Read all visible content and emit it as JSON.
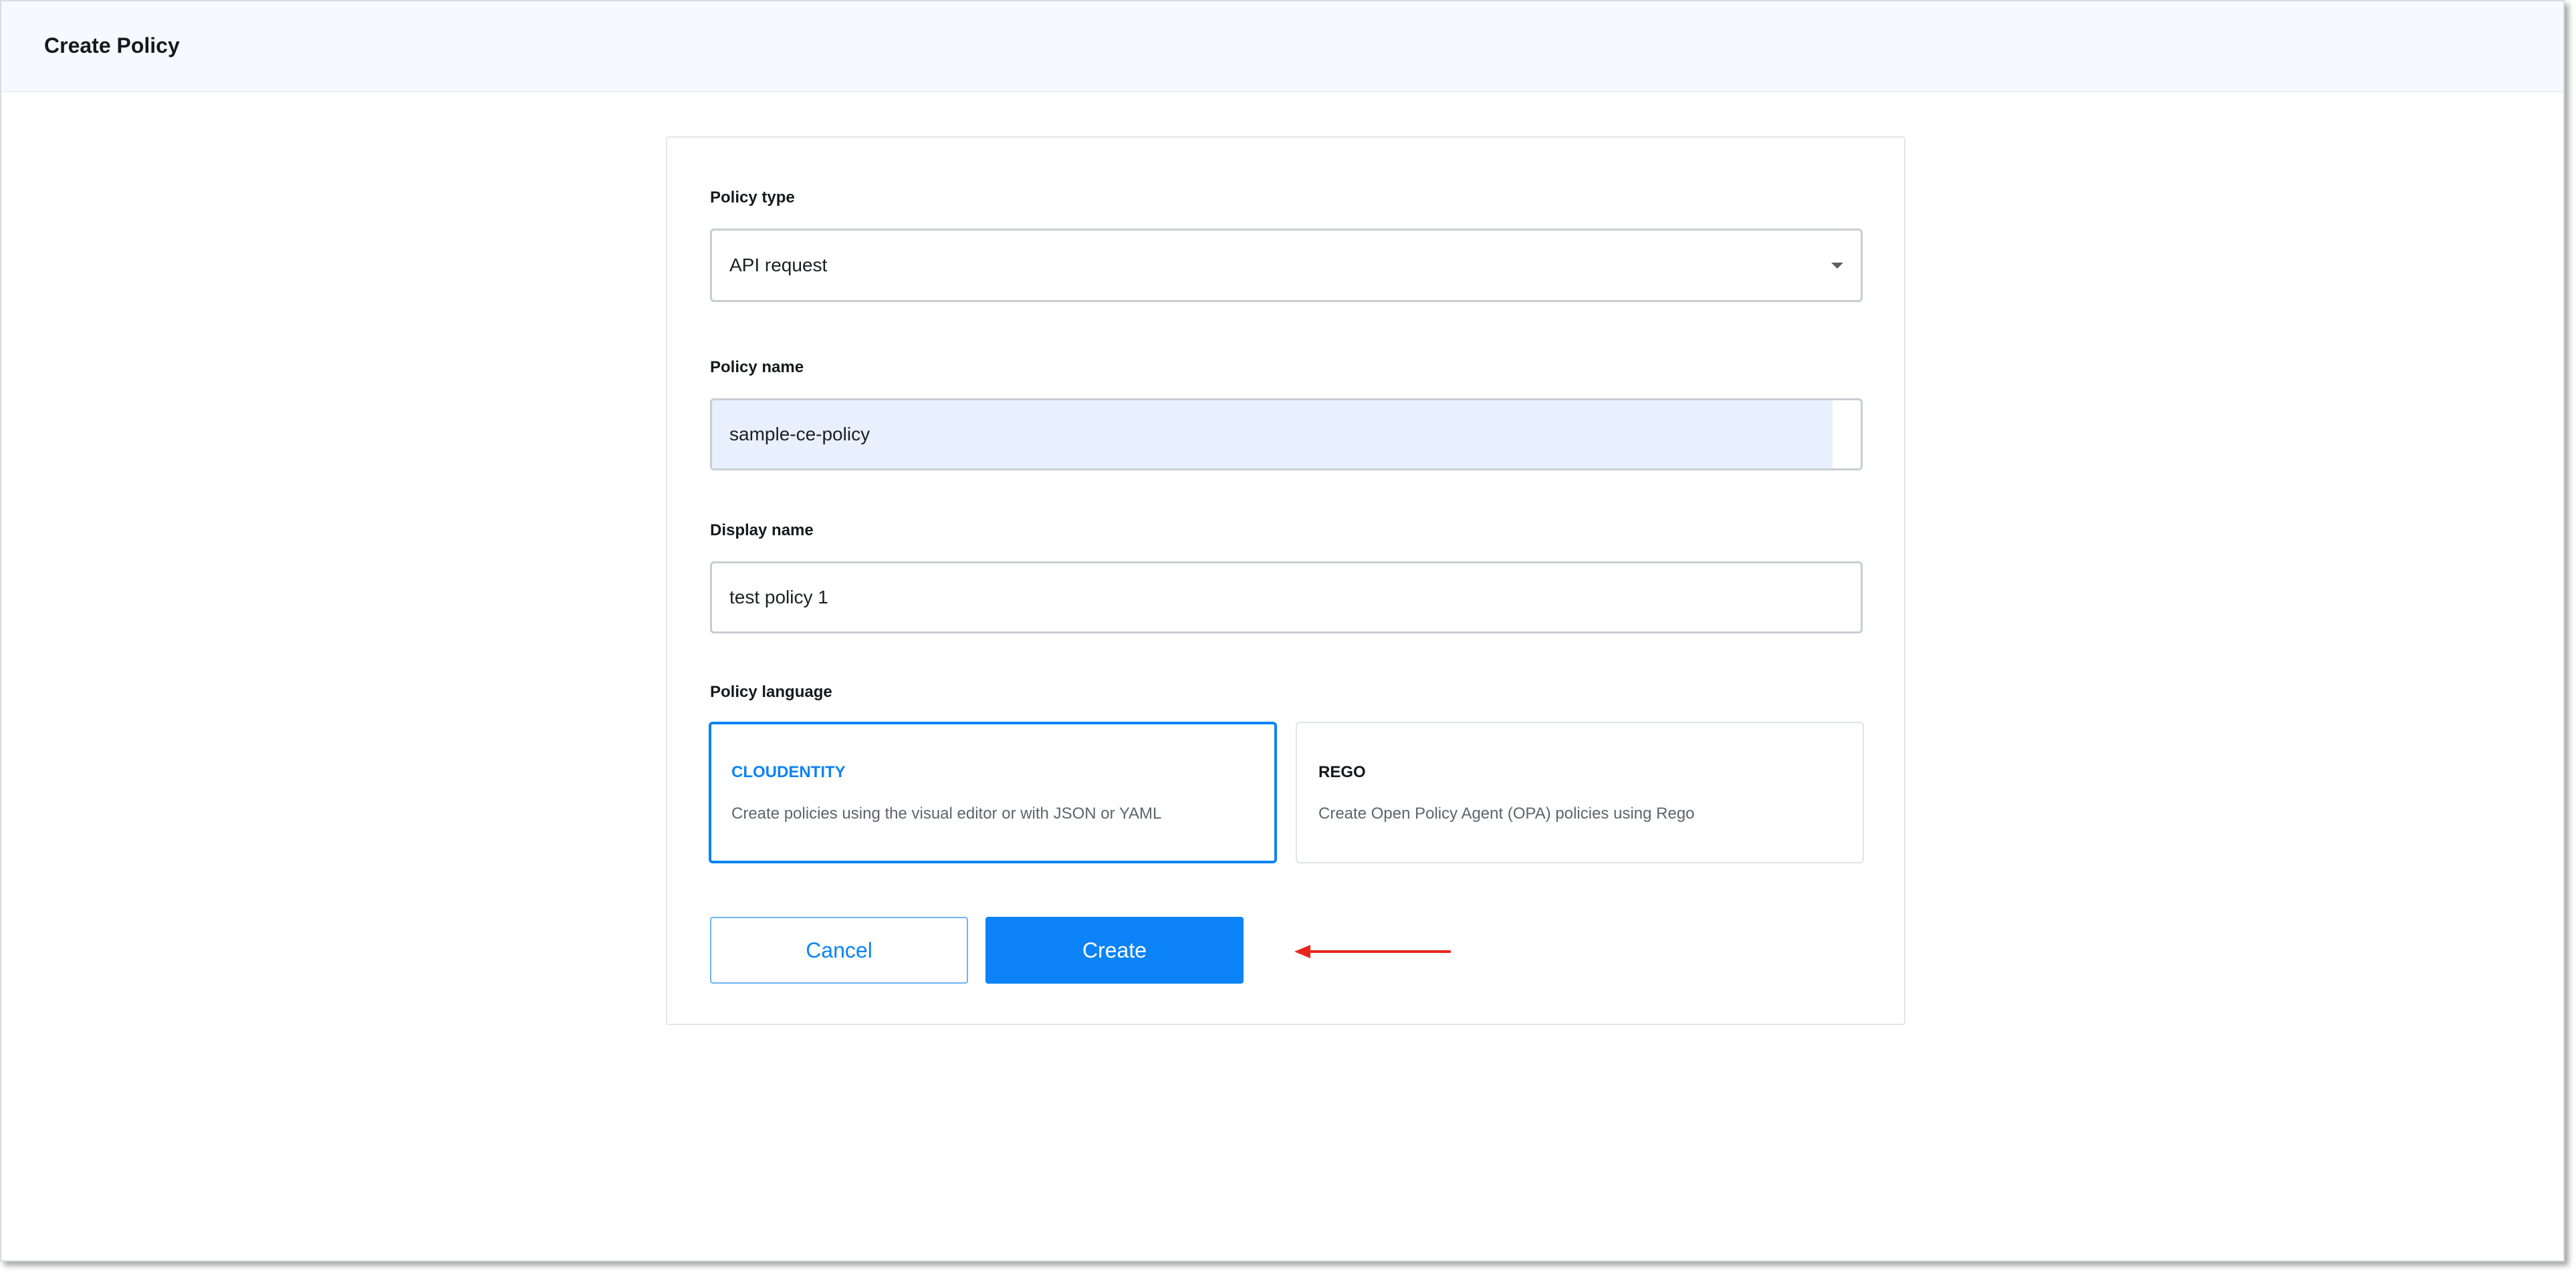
{
  "page": {
    "title": "Create Policy"
  },
  "form": {
    "policy_type": {
      "label": "Policy type",
      "value": "API request"
    },
    "policy_name": {
      "label": "Policy name",
      "value": "sample-ce-policy"
    },
    "display_name": {
      "label": "Display name",
      "value": "test policy 1"
    },
    "policy_language": {
      "label": "Policy language",
      "options": [
        {
          "title": "CLOUDENTITY",
          "description": "Create policies using the visual editor or with JSON or YAML",
          "selected": true
        },
        {
          "title": "REGO",
          "description": "Create Open Policy Agent (OPA) policies using Rego",
          "selected": false
        }
      ]
    },
    "buttons": {
      "cancel_label": "Cancel",
      "create_label": "Create"
    }
  },
  "colors": {
    "accent": "#0b83f6",
    "annotation_arrow": "#e8271c",
    "header_bg": "#f6f9fd",
    "autofill_bg": "#e8f0fe"
  },
  "icons": {
    "dropdown": "chevron-down-icon",
    "annotation": "arrow-left-icon"
  }
}
